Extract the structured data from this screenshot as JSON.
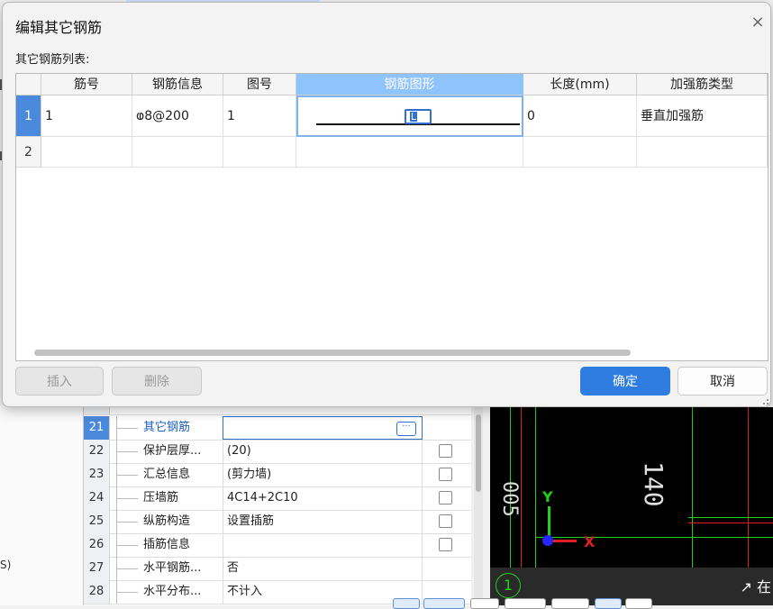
{
  "dialog": {
    "title": "编辑其它钢筋",
    "close_icon": "×",
    "subtitle": "其它钢筋列表:",
    "columns": [
      "筋号",
      "钢筋信息",
      "图号",
      "钢筋图形",
      "长度(mm)",
      "加强筋类型"
    ],
    "rows": [
      {
        "num": "1",
        "jinhao": "1",
        "info": "ⱷ8@200",
        "tuhao": "1",
        "shape_label": "L",
        "length": "0",
        "type": "垂直加强筋"
      },
      {
        "num": "2",
        "jinhao": "",
        "info": "",
        "tuhao": "",
        "shape_label": "",
        "length": "",
        "type": ""
      }
    ],
    "buttons": {
      "insert": "插入",
      "delete": "删除",
      "ok": "确定",
      "cancel": "取消"
    }
  },
  "background": {
    "left_text": "S)",
    "props": [
      {
        "num": "21",
        "name": "其它钢筋",
        "value": "",
        "button": "···",
        "selected": true
      },
      {
        "num": "22",
        "name": "保护层厚...",
        "value": "(20)"
      },
      {
        "num": "23",
        "name": "汇总信息",
        "value": "(剪力墙)"
      },
      {
        "num": "24",
        "name": "压墙筋",
        "value": "4C14+2C10"
      },
      {
        "num": "25",
        "name": "纵筋构造",
        "value": "设置插筋"
      },
      {
        "num": "26",
        "name": "插筋信息",
        "value": ""
      },
      {
        "num": "27",
        "name": "水平钢筋...",
        "value": "否"
      },
      {
        "num": "28",
        "name": "水平分布...",
        "value": "不计入"
      }
    ],
    "cad": {
      "dim_label": "140",
      "dim_label2": "005",
      "axis_y": "Y",
      "axis_x": "X",
      "grid_marker": "1",
      "status_text": "↗ 在"
    }
  }
}
